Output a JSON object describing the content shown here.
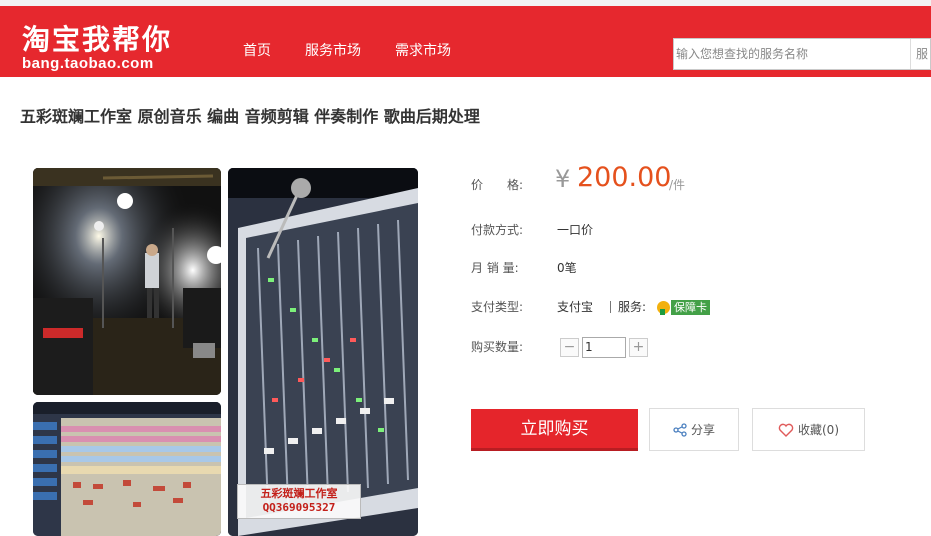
{
  "header": {
    "logo_cn": "淘宝我帮你",
    "logo_en": "bang.taobao.com",
    "nav": [
      "首页",
      "服务市场",
      "需求市场"
    ],
    "search_placeholder": "输入您想查找的服务名称",
    "search_button": "服"
  },
  "product": {
    "title": "五彩斑斓工作室 原创音乐 编曲 音频剪辑 伴奏制作 歌曲后期处理",
    "watermark_line1": "五彩斑斓工作室",
    "watermark_line2": "QQ369095327"
  },
  "details": {
    "price_label": "价　　格:",
    "price_currency": "¥",
    "price_value": "200.00",
    "price_unit": "/件",
    "pay_method_label": "付款方式:",
    "pay_method_value": "一口价",
    "monthly_sales_label": "月 销 量:",
    "monthly_sales_value": "0笔",
    "pay_type_label": "支付类型:",
    "pay_type_value": "支付宝",
    "service_label": "服务:",
    "service_badge": "保障卡",
    "quantity_label": "购买数量:",
    "quantity_value": "1",
    "minus": "−",
    "plus": "+"
  },
  "actions": {
    "buy_now": "立即购买",
    "share": "分享",
    "favorite": "收藏(0)"
  },
  "colors": {
    "brand_red": "#e6282e",
    "price_orange": "#e5511d"
  }
}
